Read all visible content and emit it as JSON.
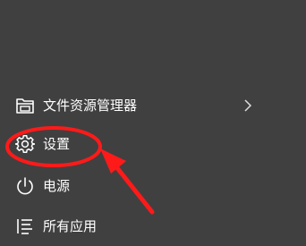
{
  "start_menu": {
    "items": [
      {
        "label": "文件资源管理器",
        "icon": "folder-explorer-icon",
        "has_submenu": true
      },
      {
        "label": "设置",
        "icon": "gear-icon"
      },
      {
        "label": "电源",
        "icon": "power-icon"
      },
      {
        "label": "所有应用",
        "icon": "list-icon"
      }
    ]
  },
  "colors": {
    "background": "#404040",
    "text": "#ffffff",
    "annotation_red": "#ff1a1a"
  }
}
